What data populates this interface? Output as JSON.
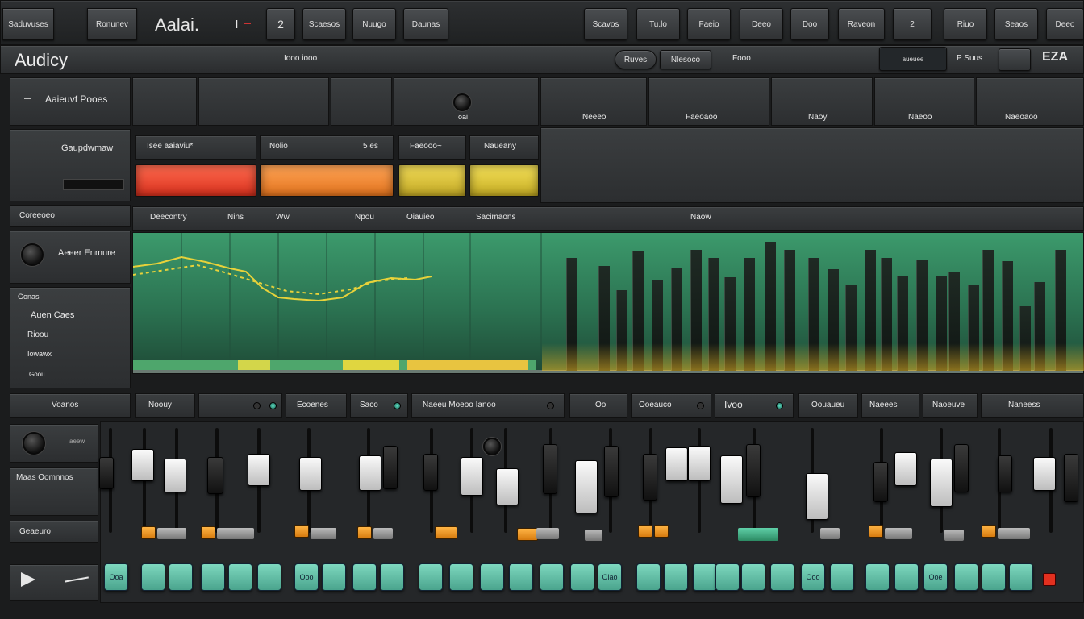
{
  "top_toolbar": {
    "left_buttons": [
      "Saduvuses",
      "Ronunev"
    ],
    "app_logo": "Aalai.",
    "small_labels": [
      "l",
      "2"
    ],
    "tab_buttons": [
      "Scaesos",
      "Nuugo",
      "Daunas"
    ],
    "right_buttons": [
      "Scavos",
      "Tu.lo",
      "Faeio",
      "Deeo",
      "Doo",
      "Raveon",
      "2",
      "Riuo",
      "Seaos",
      "Deeo"
    ]
  },
  "title_bar": {
    "title": "Audicy",
    "center_label": "Iooo iooo",
    "pill_label": "Ruves",
    "mode_label": "Nlesoco",
    "extra_label": "Fooo",
    "status_label": "aueuee",
    "status_value": "P Suus",
    "corner_label": "EZA"
  },
  "sidebar": {
    "section1_label": "Aaieuvf Pooes",
    "section2_label": "Gaupdwmaw",
    "section3_label": "Coreeoeo",
    "section4_label": "Aeeer Enmure",
    "list_items": [
      "Gonas",
      "Auen Caes",
      "Rioou",
      "Iowawx",
      "Goou"
    ],
    "section5_label": "Voanos",
    "knob_label": "aeew",
    "section6_label": "Maas Oomnnos",
    "section7_label": "Geaeuro"
  },
  "top_grid": {
    "knob_label": "oai",
    "right_headers": [
      "Neeeo",
      "Faeoaoo",
      "Naoy",
      "Naeoo",
      "Naeoaoo"
    ]
  },
  "meters": {
    "headers": [
      "Isee aaiaviu*",
      "Nolio",
      "Faeooo~",
      "Naueany"
    ],
    "header_value": "5 es",
    "colors": [
      "#e8452d",
      "#ee8a30",
      "#d6c032",
      "#d8c535"
    ]
  },
  "waveform_header": {
    "labels": [
      "Deecontry",
      "Nins",
      "Ww",
      "Npou",
      "Oiauieo",
      "Sacimaons"
    ],
    "right_label": "Naow"
  },
  "mixer_headers": [
    "Noouy",
    "Ecoenes",
    "Saco",
    "Naeeu Moeoo Ianoo",
    "Oo",
    "Ooeauco",
    "Ivoo",
    "Oouaueu",
    "Naeees",
    "Naoeuve",
    "Naneess"
  ],
  "pad_labels": [
    "Ooa",
    "Ooo",
    "Oiao",
    "Ooo",
    "Ooe"
  ],
  "colors": {
    "accent_teal": "#6fd0b3",
    "meter_green": "#3a8b63",
    "orange": "#f0a032",
    "red": "#e83a2a"
  }
}
